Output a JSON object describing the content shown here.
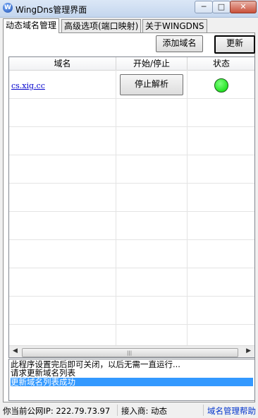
{
  "window": {
    "title": "WingDns管理界面",
    "icon": "app-logo-icon",
    "icon_letter": "W",
    "controls": {
      "minimize": "─",
      "maximize": "□",
      "close": "✕"
    }
  },
  "tabs": [
    {
      "label": "动态域名管理",
      "active": true
    },
    {
      "label": "高级选项(端口映射)",
      "active": false
    },
    {
      "label": "关于WINGDNS",
      "active": false
    }
  ],
  "toolbar": {
    "add_label": "添加域名",
    "refresh_label": "更新"
  },
  "table": {
    "columns": [
      "域名",
      "开始/停止",
      "状态"
    ],
    "rows": [
      {
        "domain": "cs.xig.cc",
        "action_label": "停止解析",
        "status": "running",
        "status_color": "#00e000"
      }
    ],
    "scroll_grip": "|||"
  },
  "log": {
    "lines": [
      "此程序设置完后即可关闭，以后无需一直运行...",
      "请求更新域名列表",
      "更新域名列表成功"
    ],
    "selected_index": 2
  },
  "statusbar": {
    "ip_text": "你当前公网IP: 222.79.73.97",
    "isp_text": "接入商: 动态",
    "help_link": "域名管理帮助"
  },
  "colors": {
    "selection": "#3399ff",
    "link": "#0000cc",
    "status_ok": "#00e000"
  }
}
